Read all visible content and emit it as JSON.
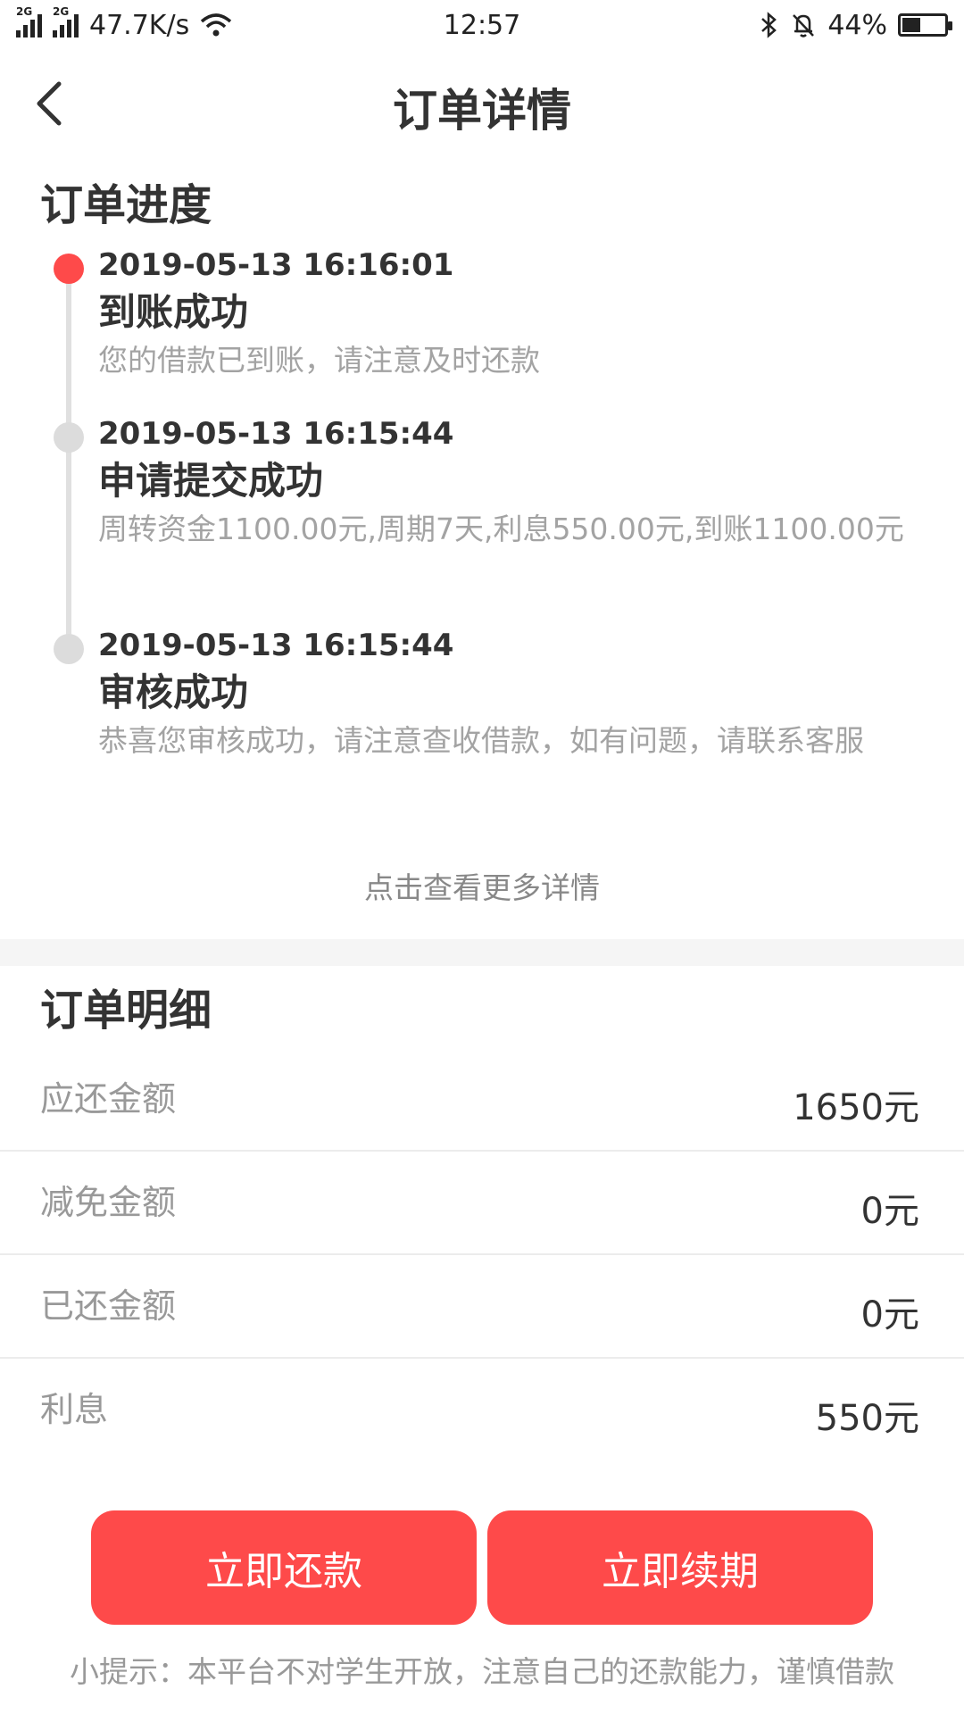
{
  "status_bar": {
    "net_label_1": "2G",
    "net_label_2": "2G",
    "speed": "47.7K/s",
    "time": "12:57",
    "battery_percent": "44%",
    "battery_level": 0.44
  },
  "header": {
    "title": "订单详情"
  },
  "progress": {
    "title": "订单进度",
    "items": [
      {
        "time": "2019-05-13 16:16:01",
        "status": "到账成功",
        "desc": "您的借款已到账，请注意及时还款",
        "active": true
      },
      {
        "time": "2019-05-13 16:15:44",
        "status": "申请提交成功",
        "desc": "周转资金1100.00元,周期7天,利息550.00元,到账1100.00元",
        "active": false
      },
      {
        "time": "2019-05-13 16:15:44",
        "status": "审核成功",
        "desc": "恭喜您审核成功，请注意查收借款，如有问题，请联系客服",
        "active": false
      }
    ],
    "more": "点击查看更多详情"
  },
  "details": {
    "title": "订单明细",
    "rows": [
      {
        "label": "应还金额",
        "value": "1650元"
      },
      {
        "label": "减免金额",
        "value": "0元"
      },
      {
        "label": "已还金额",
        "value": "0元"
      },
      {
        "label": "利息",
        "value": "550元"
      }
    ]
  },
  "actions": {
    "repay": "立即还款",
    "renew": "立即续期"
  },
  "tip": "小提示：本平台不对学生开放，注意自己的还款能力，谨慎借款",
  "colors": {
    "accent": "#fe4a4a",
    "inactive_dot": "#dcdcdc"
  }
}
